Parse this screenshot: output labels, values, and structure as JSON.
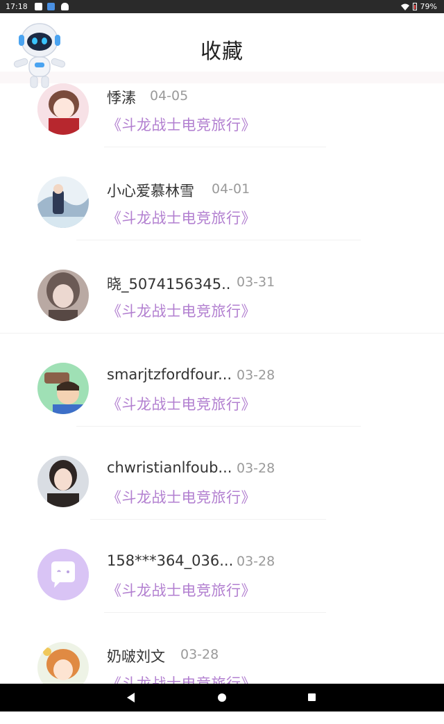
{
  "status_bar": {
    "time": "17:18",
    "battery": "79%",
    "icons": [
      "image-icon",
      "app-icon",
      "android-icon",
      "wifi-icon",
      "battery-icon"
    ]
  },
  "header": {
    "title": "收藏",
    "mascot": "robot-mascot-icon"
  },
  "favorites": [
    {
      "name": "悸溸",
      "date": "04-05",
      "book": "《斗龙战士电竞旅行》",
      "avatar": "anime-girl-avatar"
    },
    {
      "name": "小心爱慕林雪",
      "date": "04-01",
      "book": "《斗龙战士电竞旅行》",
      "avatar": "anime-scene-avatar"
    },
    {
      "name": "晓_5074156345..",
      "date": "03-31",
      "book": "《斗龙战士电竞旅行》",
      "avatar": "girl-portrait-avatar"
    },
    {
      "name": "smarjtzfordfour...",
      "date": "03-28",
      "book": "《斗龙战士电竞旅行》",
      "avatar": "cartoon-boy-avatar"
    },
    {
      "name": "chwristianlfoub...",
      "date": "03-28",
      "book": "《斗龙战士电竞旅行》",
      "avatar": "photo-girl-avatar"
    },
    {
      "name": "158***364_036...",
      "date": "03-28",
      "book": "《斗龙战士电竞旅行》",
      "avatar": "default-chat-avatar"
    },
    {
      "name": "奶啵刘文",
      "date": "03-28",
      "book": "《斗龙战士电竞旅行》",
      "avatar": "anime-redhead-avatar"
    }
  ],
  "colors": {
    "book_title": "#b27fd0",
    "date": "#9a9a9a",
    "name": "#333333",
    "default_avatar": "#d9c4f5"
  },
  "nav_bar": {
    "buttons": [
      "back-icon",
      "home-icon",
      "recents-icon"
    ]
  }
}
